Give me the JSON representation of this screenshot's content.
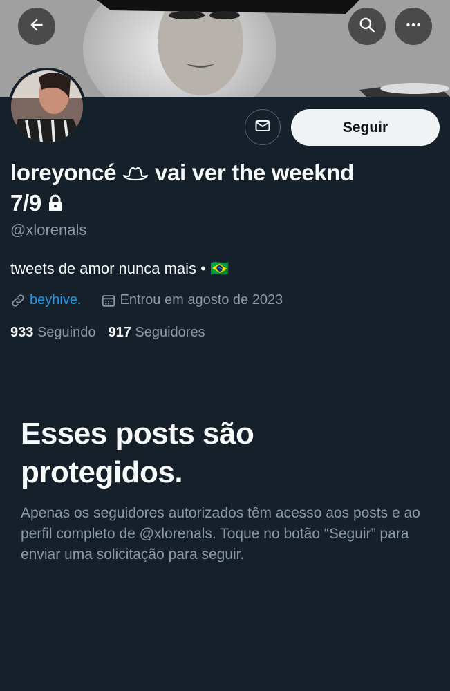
{
  "header": {
    "back_icon": "arrow-left-icon",
    "search_icon": "search-icon",
    "more_icon": "more-horizontal-icon"
  },
  "profile": {
    "name_line1": "loreyoncé ",
    "name_after_emoji": " vai ver the weeknd",
    "name_line2": "7/9 ",
    "cowboy_hat_icon": "cowboy-hat-icon",
    "lock_icon": "lock-icon",
    "handle": "@xlorenals",
    "bio": "tweets de amor nunca mais • ",
    "flag": "🇧🇷",
    "link_text": "beyhive.",
    "joined": "Entrou em agosto de 2023",
    "following_count": "933",
    "following_label": "Seguindo",
    "followers_count": "917",
    "followers_label": "Seguidores"
  },
  "actions": {
    "follow_label": "Seguir",
    "message_icon": "mail-icon"
  },
  "protected": {
    "title": "Esses posts são protegidos.",
    "text": "Apenas os seguidores autorizados têm acesso aos posts e ao perfil completo de @xlorenals. Toque no botão “Seguir” para enviar uma solicitação para seguir."
  },
  "colors": {
    "background": "#15202b",
    "link": "#1d9bf0",
    "secondary_text": "#8b98a5",
    "button_bg": "#eff3f4"
  }
}
